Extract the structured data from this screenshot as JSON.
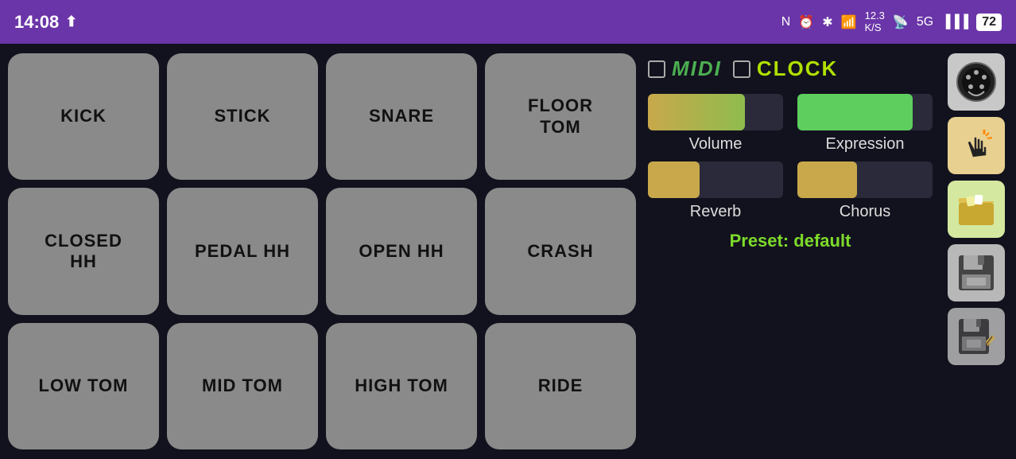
{
  "statusBar": {
    "time": "14:08",
    "battery": "72"
  },
  "pads": [
    {
      "label": "KICK",
      "id": "kick"
    },
    {
      "label": "STICK",
      "id": "stick"
    },
    {
      "label": "SNARE",
      "id": "snare"
    },
    {
      "label": "FLOOR\nTOM",
      "id": "floor-tom"
    },
    {
      "label": "CLOSED\nHH",
      "id": "closed-hh"
    },
    {
      "label": "PEDAL HH",
      "id": "pedal-hh"
    },
    {
      "label": "OPEN HH",
      "id": "open-hh"
    },
    {
      "label": "CRASH",
      "id": "crash"
    },
    {
      "label": "LOW TOM",
      "id": "low-tom"
    },
    {
      "label": "MID TOM",
      "id": "mid-tom"
    },
    {
      "label": "HIGH TOM",
      "id": "high-tom"
    },
    {
      "label": "RIDE",
      "id": "ride"
    }
  ],
  "controls": {
    "midiLabel": "MIDI",
    "clockLabel": "CLOCK",
    "volumeLabel": "Volume",
    "expressionLabel": "Expression",
    "reverbLabel": "Reverb",
    "chorusLabel": "Chorus",
    "presetLabel": "Preset: default"
  }
}
